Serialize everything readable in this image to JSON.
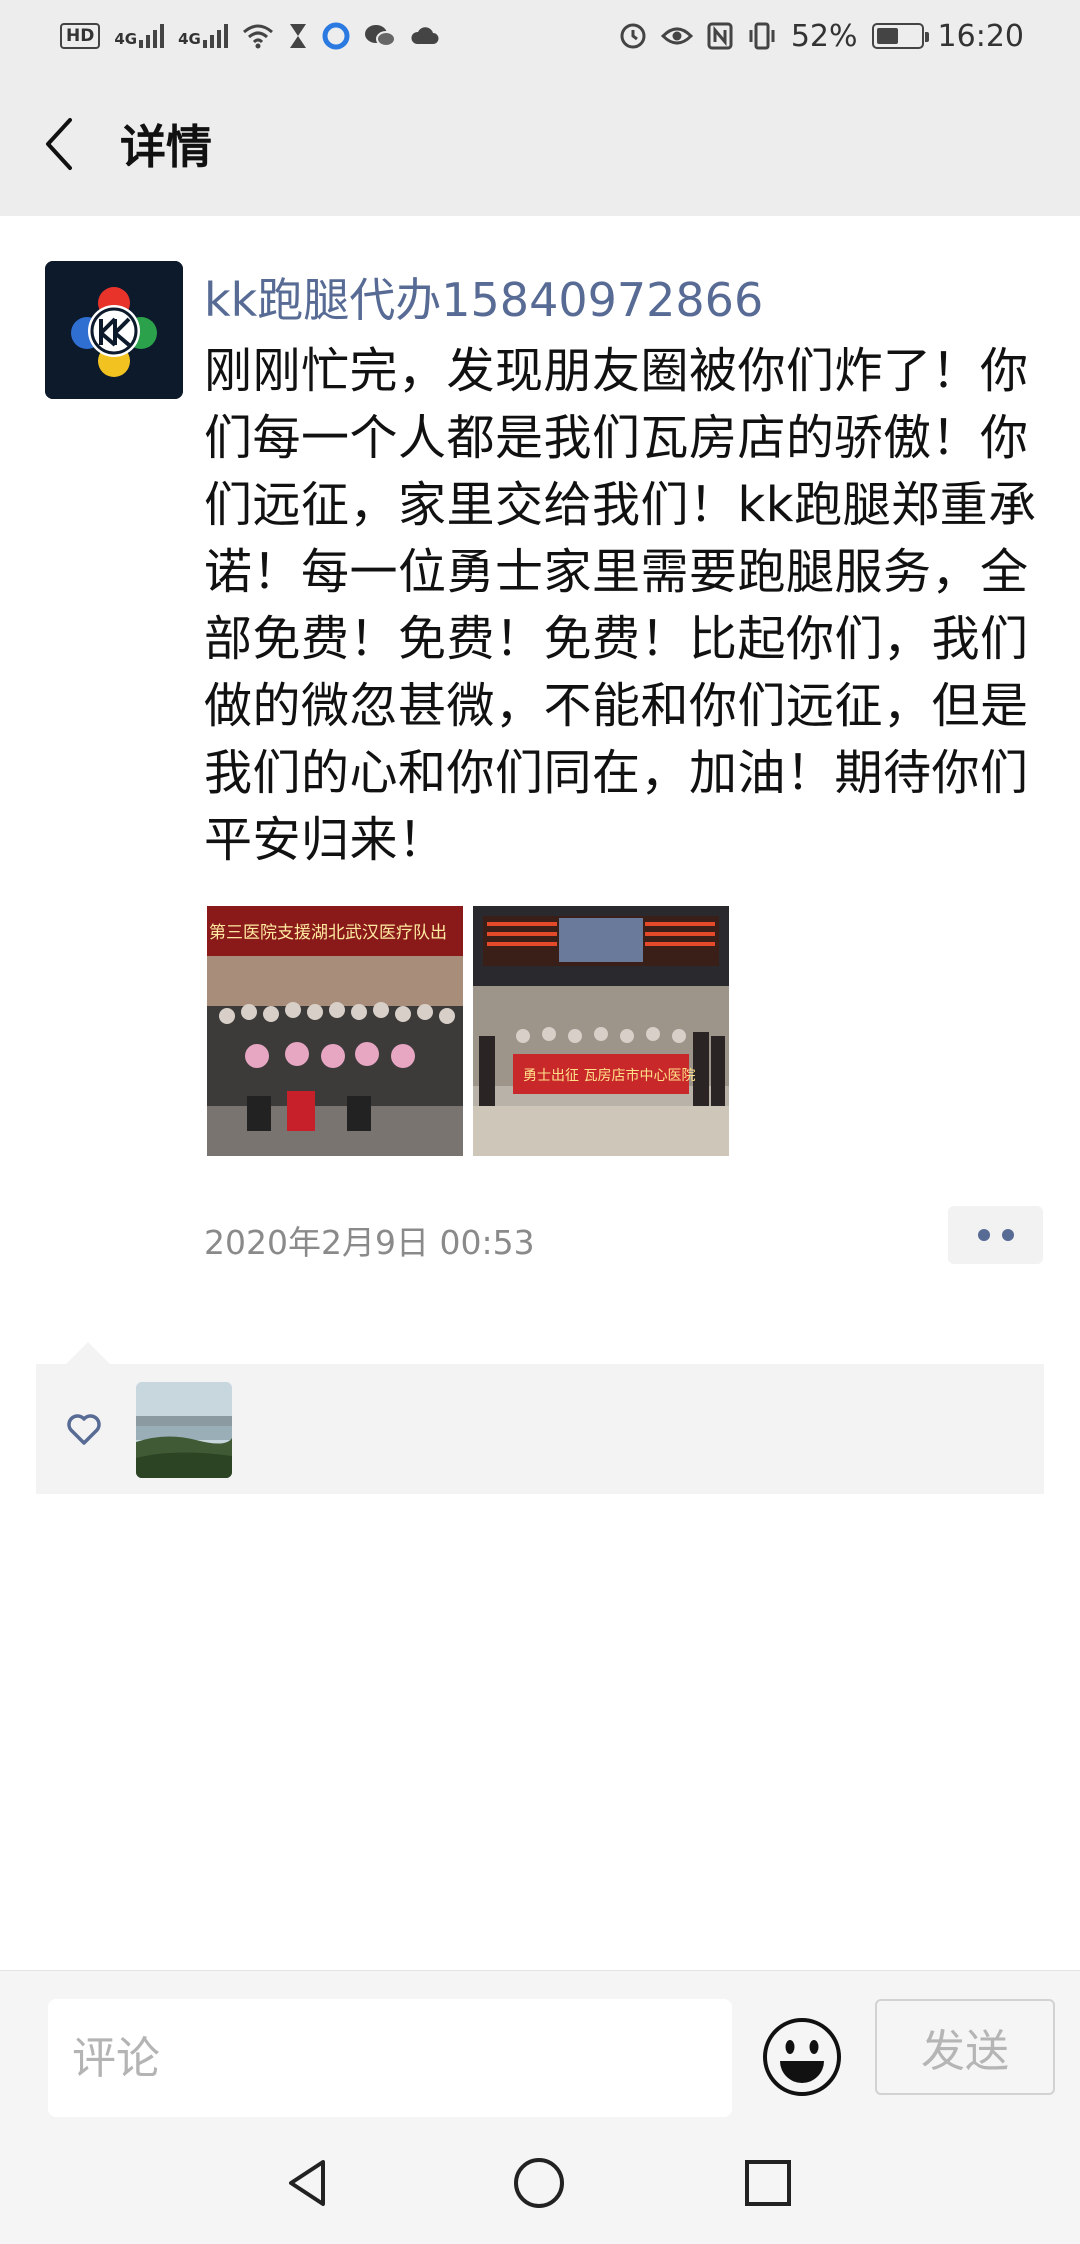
{
  "status_bar": {
    "left_badge": "HD",
    "signal1": "4G",
    "signal2": "4G",
    "battery_percent": "52%",
    "battery_level": 0.52,
    "time": "16:20"
  },
  "header": {
    "title": "详情"
  },
  "post": {
    "author": "kk跑腿代办15840972866",
    "content": "刚刚忙完，发现朋友圈被你们炸了！你们每一个人都是我们瓦房店的骄傲！你们远征，家里交给我们！kk跑腿郑重承诺！每一位勇士家里需要跑腿服务，全部免费！免费！免费！比起你们，我们做的微忽甚微，不能和你们远征，但是我们的心和你们同在，加油！期待你们平安归来！",
    "image1_banner": "第三医院支援湖北武汉医疗队出",
    "image2_banner": "勇士出征 瓦房店市中心医院",
    "timestamp": "2020年2月9日 00:53"
  },
  "comment_bar": {
    "placeholder": "评论",
    "send_label": "发送"
  },
  "icons": {
    "back": "chevron-left-icon",
    "more": "more-dots-icon",
    "like": "heart-icon",
    "emoji": "smiley-icon"
  },
  "colors": {
    "author_link": "#576b95",
    "bar_background": "#ededed",
    "timestamp": "#8a8a8a"
  }
}
